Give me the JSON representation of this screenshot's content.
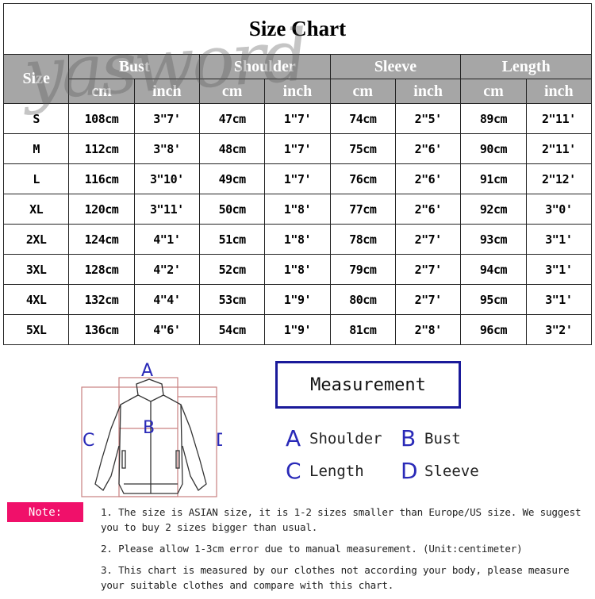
{
  "title": "Size Chart",
  "watermark": "yasword",
  "headers": {
    "size": "Size",
    "groups": [
      "Bust",
      "Shoulder",
      "Sleeve",
      "Length"
    ],
    "units": [
      "cm",
      "inch",
      "cm",
      "inch",
      "cm",
      "inch",
      "cm",
      "inch"
    ]
  },
  "rows": [
    [
      "S",
      "108cm",
      "3\"7'",
      "47cm",
      "1\"7'",
      "74cm",
      "2\"5'",
      "89cm",
      "2\"11'"
    ],
    [
      "M",
      "112cm",
      "3\"8'",
      "48cm",
      "1\"7'",
      "75cm",
      "2\"6'",
      "90cm",
      "2\"11'"
    ],
    [
      "L",
      "116cm",
      "3\"10'",
      "49cm",
      "1\"7'",
      "76cm",
      "2\"6'",
      "91cm",
      "2\"12'"
    ],
    [
      "XL",
      "120cm",
      "3\"11'",
      "50cm",
      "1\"8'",
      "77cm",
      "2\"6'",
      "92cm",
      "3\"0'"
    ],
    [
      "2XL",
      "124cm",
      "4\"1'",
      "51cm",
      "1\"8'",
      "78cm",
      "2\"7'",
      "93cm",
      "3\"1'"
    ],
    [
      "3XL",
      "128cm",
      "4\"2'",
      "52cm",
      "1\"8'",
      "79cm",
      "2\"7'",
      "94cm",
      "3\"1'"
    ],
    [
      "4XL",
      "132cm",
      "4\"4'",
      "53cm",
      "1\"9'",
      "80cm",
      "2\"7'",
      "95cm",
      "3\"1'"
    ],
    [
      "5XL",
      "136cm",
      "4\"6'",
      "54cm",
      "1\"9'",
      "81cm",
      "2\"8'",
      "96cm",
      "3\"2'"
    ]
  ],
  "diagram": {
    "labels": [
      "A",
      "B",
      "C",
      "D"
    ]
  },
  "measurement": {
    "title": "Measurement",
    "items": [
      {
        "letter": "A",
        "label": "Shoulder"
      },
      {
        "letter": "B",
        "label": "Bust"
      },
      {
        "letter": "C",
        "label": "Length"
      },
      {
        "letter": "D",
        "label": "Sleeve"
      }
    ]
  },
  "note": {
    "label": "Note:",
    "lines": [
      "1. The size is ASIAN size, it is 1-2 sizes smaller than Europe/US size. We suggest you to buy 2 sizes bigger than usual.",
      "2. Please allow 1-3cm error due to manual measurement. (Unit:centimeter)",
      "3. This chart is measured by our clothes not according your body, please measure your suitable clothes and compare with this chart."
    ]
  },
  "colors": {
    "header_bg": "#a6a6a6",
    "accent_blue": "#2a2ab8",
    "note_pink": "#f0106a",
    "guide_lines": "#c98080"
  }
}
